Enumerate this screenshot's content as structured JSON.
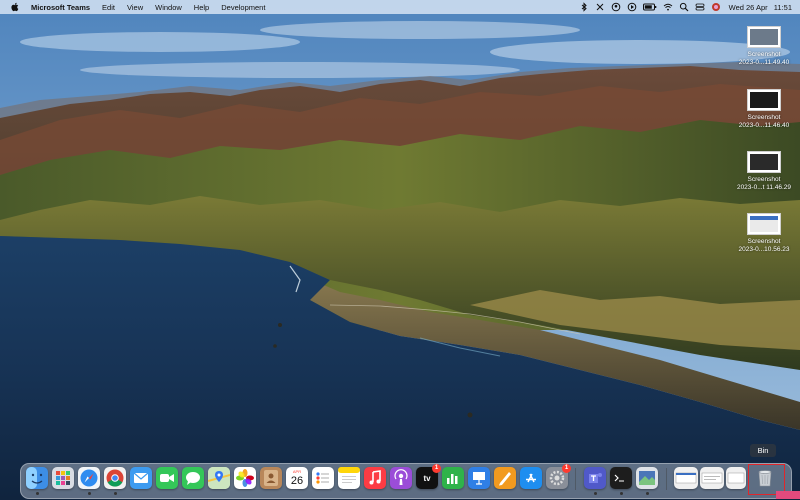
{
  "menubar": {
    "app_name": "Microsoft Teams",
    "items": [
      "Edit",
      "View",
      "Window",
      "Help",
      "Development"
    ],
    "date": "Wed 26 Apr",
    "time": "11:51",
    "status_icons": [
      "bluetooth-icon",
      "timer-icon",
      "teams-status-icon",
      "play-icon",
      "battery-icon",
      "wifi-icon",
      "search-icon",
      "control-center-icon",
      "siri-icon"
    ]
  },
  "desktop": {
    "files": [
      {
        "name": "Screenshot",
        "date": "2023-0...11.49.40"
      },
      {
        "name": "Screenshot",
        "date": "2023-0...11.46.40"
      },
      {
        "name": "Screenshot",
        "date": "2023-0...t 11.46.29"
      },
      {
        "name": "Screenshot",
        "date": "2023-0...10.56.23"
      }
    ]
  },
  "dock": {
    "apps": [
      {
        "name": "Finder",
        "icon": "finder-icon"
      },
      {
        "name": "Launchpad",
        "icon": "launchpad-icon"
      },
      {
        "name": "Safari",
        "icon": "safari-icon"
      },
      {
        "name": "Google Chrome",
        "icon": "chrome-icon"
      },
      {
        "name": "Mail",
        "icon": "mail-icon"
      },
      {
        "name": "FaceTime",
        "icon": "facetime-icon"
      },
      {
        "name": "Messages",
        "icon": "messages-icon"
      },
      {
        "name": "Maps",
        "icon": "maps-icon"
      },
      {
        "name": "Photos",
        "icon": "photos-icon"
      },
      {
        "name": "Contacts",
        "icon": "contacts-icon"
      },
      {
        "name": "Calendar",
        "icon": "calendar-icon",
        "month": "APR",
        "day": "26"
      },
      {
        "name": "Reminders",
        "icon": "reminders-icon"
      },
      {
        "name": "Notes",
        "icon": "notes-icon"
      },
      {
        "name": "Music",
        "icon": "music-icon"
      },
      {
        "name": "Podcasts",
        "icon": "podcasts-icon"
      },
      {
        "name": "TV",
        "icon": "tv-icon",
        "label": "tv",
        "badge": "1"
      },
      {
        "name": "Numbers",
        "icon": "numbers-icon"
      },
      {
        "name": "Keynote",
        "icon": "keynote-icon"
      },
      {
        "name": "Pages",
        "icon": "pages-icon"
      },
      {
        "name": "App Store",
        "icon": "app-store-icon"
      },
      {
        "name": "System Preferences",
        "icon": "system-preferences-icon",
        "badge": "1"
      },
      {
        "name": "Microsoft Teams",
        "icon": "teams-icon"
      },
      {
        "name": "Terminal",
        "icon": "terminal-icon"
      },
      {
        "name": "Preview",
        "icon": "preview-icon"
      }
    ],
    "bin_tooltip": "Bin"
  },
  "colors": {
    "menubar_bg": "#e1ecf7",
    "highlight": "#e0262b",
    "badge": "#ff3b30",
    "watermark": "#e34a7d"
  }
}
